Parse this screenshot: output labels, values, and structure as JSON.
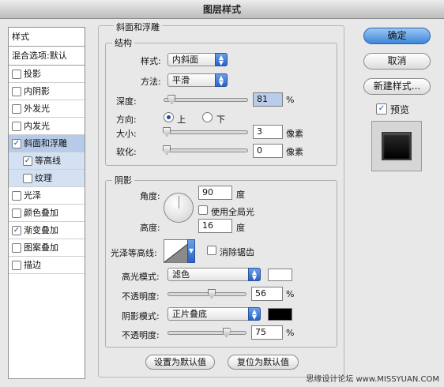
{
  "window": {
    "title": "图层样式"
  },
  "style_list": {
    "header": "样式",
    "blend_options": "混合选项:默认",
    "items": [
      {
        "label": "投影",
        "checked": false
      },
      {
        "label": "内阴影",
        "checked": false
      },
      {
        "label": "外发光",
        "checked": false
      },
      {
        "label": "内发光",
        "checked": false
      },
      {
        "label": "斜面和浮雕",
        "checked": true,
        "selected": true
      },
      {
        "label": "等高线",
        "checked": true,
        "sub": true
      },
      {
        "label": "纹理",
        "checked": false,
        "sub": true
      },
      {
        "label": "光泽",
        "checked": false
      },
      {
        "label": "颜色叠加",
        "checked": false
      },
      {
        "label": "渐变叠加",
        "checked": true
      },
      {
        "label": "图案叠加",
        "checked": false
      },
      {
        "label": "描边",
        "checked": false
      }
    ]
  },
  "bevel": {
    "title": "斜面和浮雕",
    "structure": {
      "title": "结构",
      "style_label": "样式:",
      "style_value": "内斜面",
      "technique_label": "方法:",
      "technique_value": "平滑",
      "depth_label": "深度:",
      "depth_value": "81",
      "depth_unit": "%",
      "direction_label": "方向:",
      "direction_up": "上",
      "direction_down": "下",
      "direction_selected": "上",
      "size_label": "大小:",
      "size_value": "3",
      "size_unit": "像素",
      "soften_label": "软化:",
      "soften_value": "0",
      "soften_unit": "像素"
    },
    "shading": {
      "title": "阴影",
      "angle_label": "角度:",
      "angle_value": "90",
      "angle_unit": "度",
      "global_light_label": "使用全局光",
      "global_light_checked": false,
      "altitude_label": "高度:",
      "altitude_value": "16",
      "altitude_unit": "度",
      "gloss_contour_label": "光泽等高线:",
      "anti_alias_label": "消除锯齿",
      "anti_alias_checked": false,
      "highlight_mode_label": "高光模式:",
      "highlight_mode_value": "滤色",
      "highlight_color": "#ffffff",
      "highlight_opacity_label": "不透明度:",
      "highlight_opacity_value": "56",
      "highlight_opacity_unit": "%",
      "shadow_mode_label": "阴影模式:",
      "shadow_mode_value": "正片叠底",
      "shadow_color": "#000000",
      "shadow_opacity_label": "不透明度:",
      "shadow_opacity_value": "75",
      "shadow_opacity_unit": "%"
    },
    "make_default": "设置为默认值",
    "reset_default": "复位为默认值"
  },
  "actions": {
    "ok": "确定",
    "cancel": "取消",
    "new_style": "新建样式...",
    "preview_label": "预览",
    "preview_checked": true
  },
  "watermark": "思缘设计论坛  www.MISSYUAN.COM",
  "colors": {
    "accent": "#3d86da",
    "selection": "#b5cbe9"
  }
}
